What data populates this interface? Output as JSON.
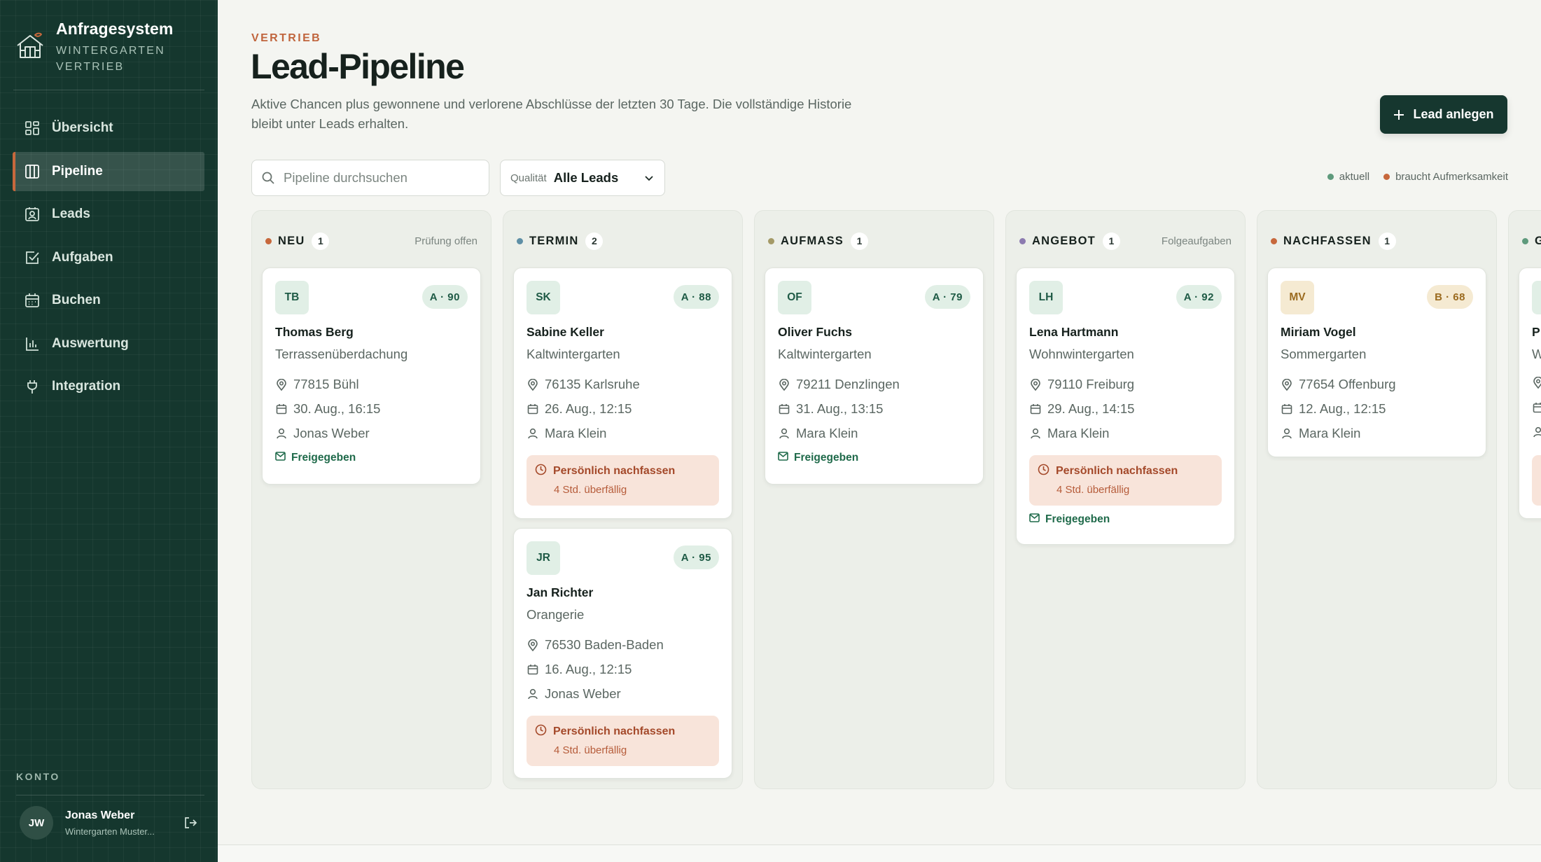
{
  "app": {
    "title": "Anfragesystem",
    "subtitle": "WINTERGARTEN VERTRIEB"
  },
  "nav": [
    {
      "label": "Übersicht",
      "icon": "dashboard-icon",
      "active": false
    },
    {
      "label": "Pipeline",
      "icon": "columns-icon",
      "active": true
    },
    {
      "label": "Leads",
      "icon": "contact-icon",
      "active": false
    },
    {
      "label": "Aufgaben",
      "icon": "checkbox-icon",
      "active": false
    },
    {
      "label": "Buchen",
      "icon": "calendar-icon",
      "active": false
    },
    {
      "label": "Auswertung",
      "icon": "bar-chart-icon",
      "active": false
    },
    {
      "label": "Integration",
      "icon": "plug-icon",
      "active": false
    }
  ],
  "account": {
    "section_label": "KONTO",
    "initials": "JW",
    "name": "Jonas Weber",
    "org": "Wintergarten Muster..."
  },
  "header": {
    "eyebrow": "VERTRIEB",
    "title": "Lead-Pipeline",
    "description": "Aktive Chancen plus gewonnene und verlorene Abschlüsse der letzten 30 Tage. Die vollständige Historie bleibt unter Leads erhalten.",
    "primary_button": "Lead anlegen"
  },
  "toolbar": {
    "search_placeholder": "Pipeline durchsuchen",
    "quality_label": "Qualität",
    "quality_value": "Alle Leads"
  },
  "legend": [
    {
      "label": "aktuell",
      "color": "#5e9a7c"
    },
    {
      "label": "braucht Aufmerksamkeit",
      "color": "#c7683c"
    }
  ],
  "colors": {
    "sidebar": "#15372e",
    "accent": "#c7683c",
    "primary": "#16372f"
  },
  "columns": [
    {
      "title": "NEU",
      "count": "1",
      "note": "Prüfung offen",
      "dot": "#c7683c",
      "cards": [
        {
          "initials": "TB",
          "score": "A · 90",
          "name": "Thomas Berg",
          "type": "Terrassenüberdachung",
          "location": "77815 Bühl",
          "date": "30. Aug., 16:15",
          "owner": "Jonas Weber",
          "alert": null,
          "status": "Freigegeben"
        }
      ]
    },
    {
      "title": "TERMIN",
      "count": "2",
      "note": "",
      "dot": "#5e8fa6",
      "cards": [
        {
          "initials": "SK",
          "score": "A · 88",
          "name": "Sabine Keller",
          "type": "Kaltwintergarten",
          "location": "76135 Karlsruhe",
          "date": "26. Aug., 12:15",
          "owner": "Mara Klein",
          "alert": {
            "title": "Persönlich nachfassen",
            "sub": "4 Std. überfällig"
          },
          "status": null
        },
        {
          "initials": "JR",
          "score": "A · 95",
          "name": "Jan Richter",
          "type": "Orangerie",
          "location": "76530 Baden-Baden",
          "date": "16. Aug., 12:15",
          "owner": "Jonas Weber",
          "alert": {
            "title": "Persönlich nachfassen",
            "sub": "4 Std. überfällig"
          },
          "status": null
        }
      ]
    },
    {
      "title": "AUFMASS",
      "count": "1",
      "note": "",
      "dot": "#a49a67",
      "cards": [
        {
          "initials": "OF",
          "score": "A · 79",
          "name": "Oliver Fuchs",
          "type": "Kaltwintergarten",
          "location": "79211 Denzlingen",
          "date": "31. Aug., 13:15",
          "owner": "Mara Klein",
          "alert": null,
          "status": "Freigegeben"
        }
      ]
    },
    {
      "title": "ANGEBOT",
      "count": "1",
      "note": "Folgeaufgaben",
      "dot": "#8c7bb0",
      "cards": [
        {
          "initials": "LH",
          "score": "A · 92",
          "name": "Lena Hartmann",
          "type": "Wohnwintergarten",
          "location": "79110 Freiburg",
          "date": "29. Aug., 14:15",
          "owner": "Mara Klein",
          "alert": {
            "title": "Persönlich nachfassen",
            "sub": "4 Std. überfällig"
          },
          "status": "Freigegeben"
        }
      ]
    },
    {
      "title": "NACHFASSEN",
      "count": "1",
      "note": "",
      "dot": "#c7683c",
      "cards": [
        {
          "initials": "MV",
          "score": "B · 68",
          "name": "Miriam Vogel",
          "type": "Sommergarten",
          "location": "77654 Offenburg",
          "date": "12. Aug., 12:15",
          "owner": "Mara Klein",
          "alert": null,
          "status": null
        }
      ]
    },
    {
      "title": "G",
      "count": "",
      "note": "",
      "dot": "#5e9a7c",
      "cards": [
        {
          "initials": "",
          "score": "",
          "name": "P",
          "type": "W",
          "location": "",
          "date": "",
          "owner": "",
          "alert": {
            "title": "",
            "sub": ""
          },
          "status": null
        }
      ]
    }
  ]
}
